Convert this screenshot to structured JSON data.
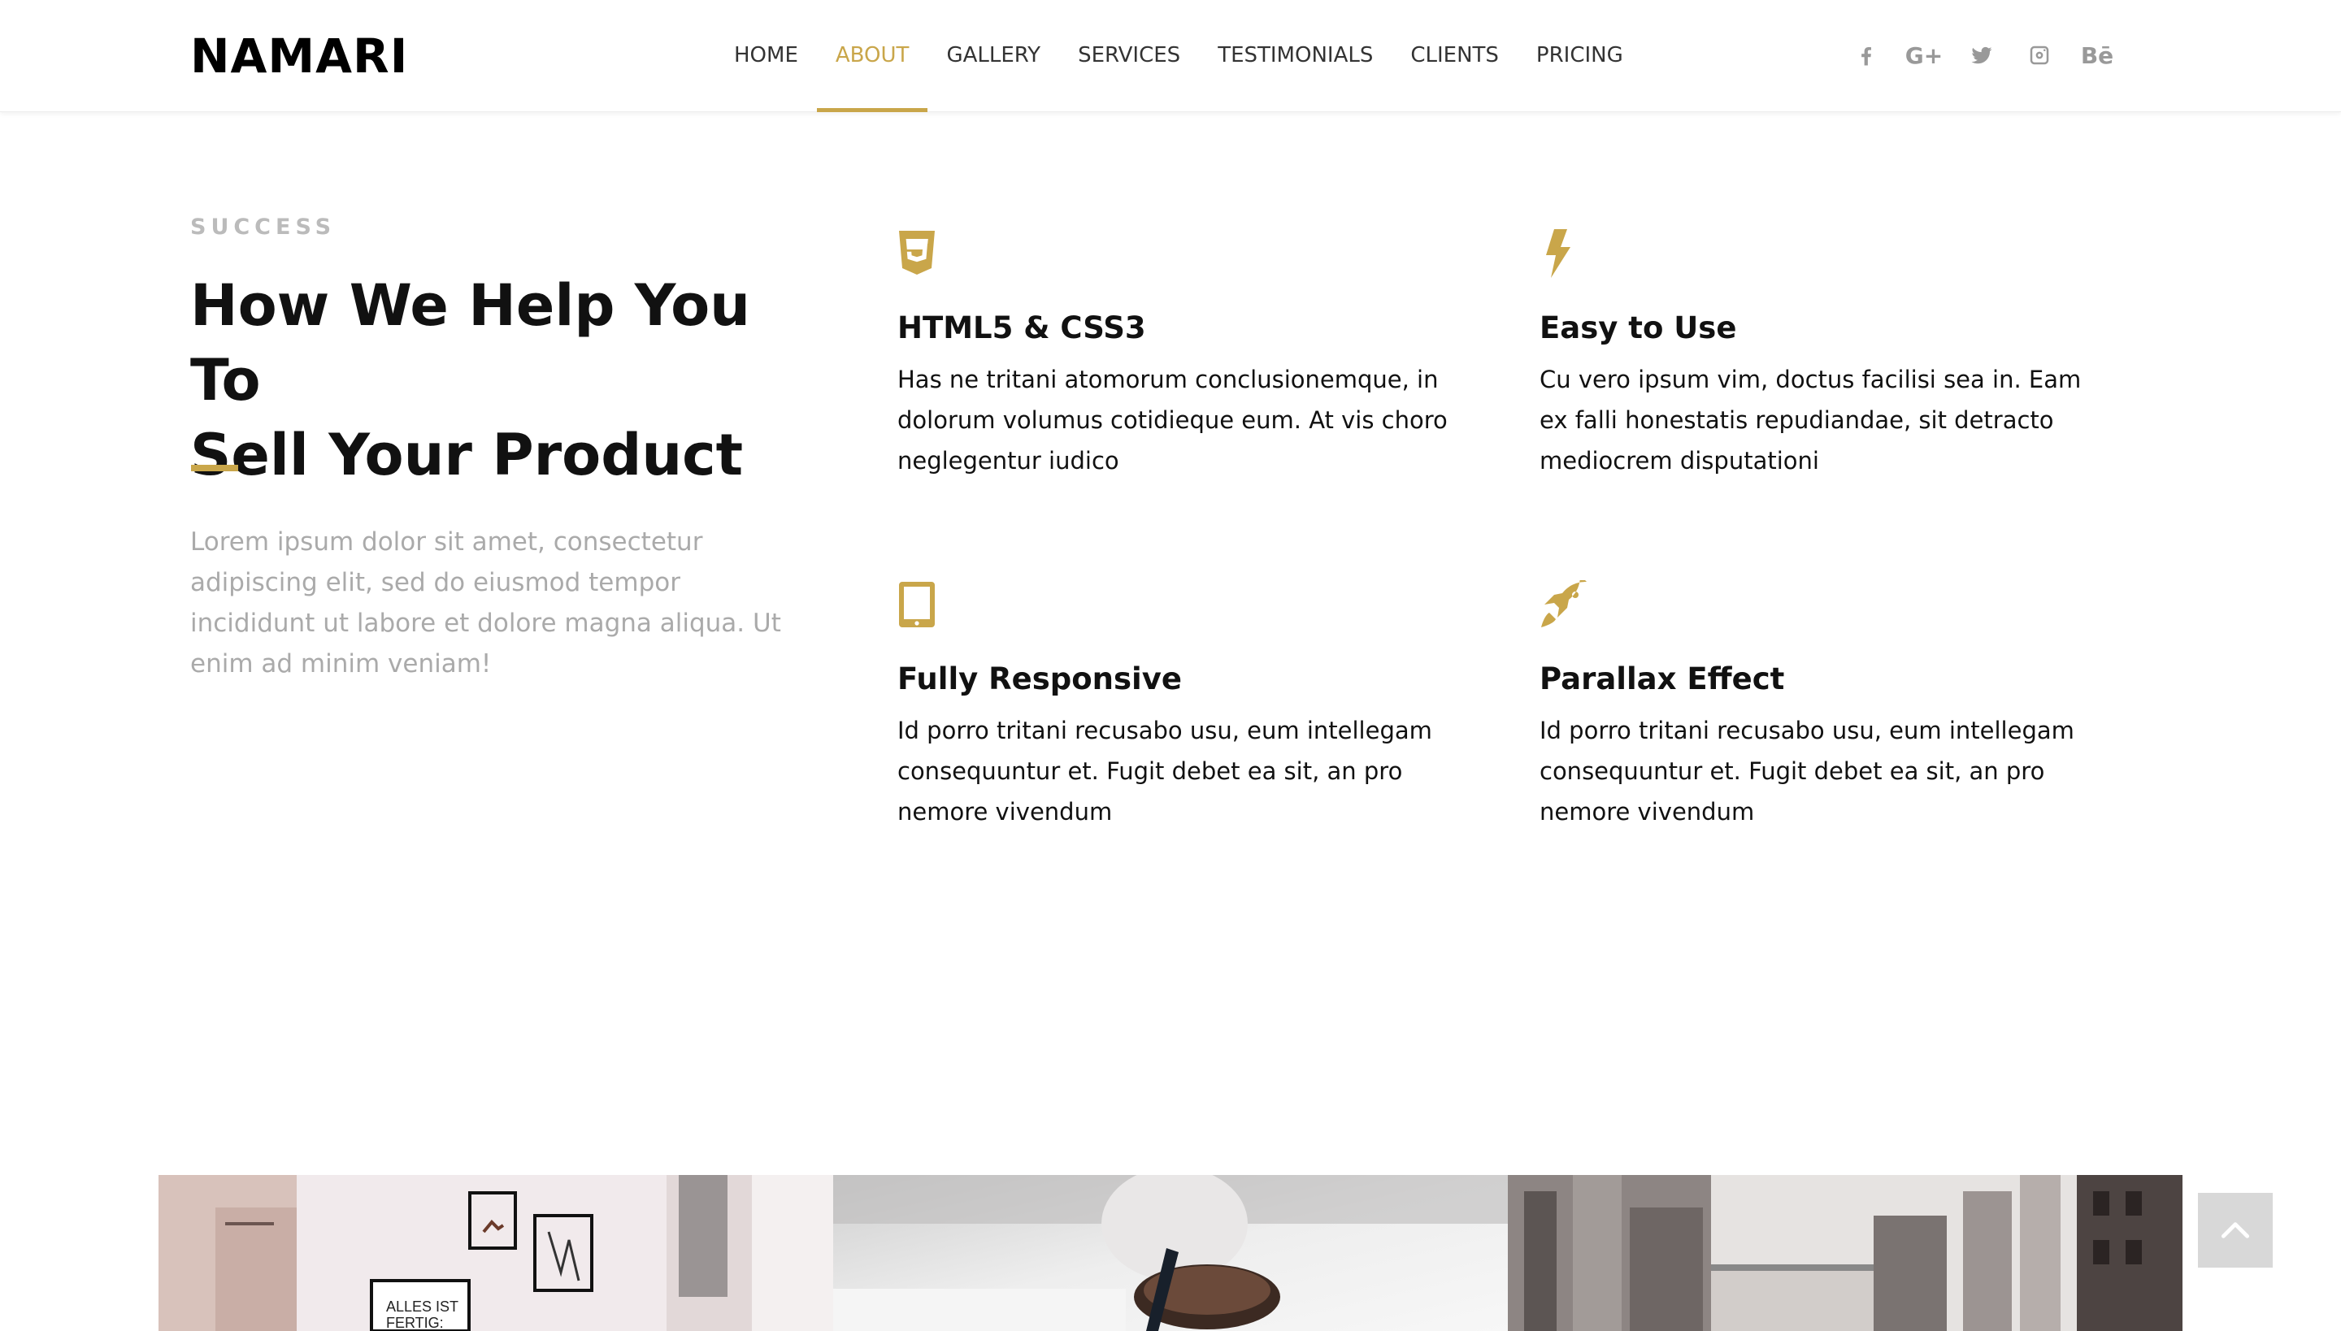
{
  "brand": {
    "logo": "NAMARI",
    "accent": "#c9a64a"
  },
  "nav": {
    "items": [
      "HOME",
      "ABOUT",
      "GALLERY",
      "SERVICES",
      "TESTIMONIALS",
      "CLIENTS",
      "PRICING"
    ],
    "active": "ABOUT"
  },
  "social": {
    "icons": [
      "facebook-icon",
      "google-plus-icon",
      "twitter-icon",
      "instagram-icon",
      "behance-icon"
    ],
    "google_plus_label": "G+",
    "behance_label": "Bē"
  },
  "about": {
    "eyebrow": "SUCCESS",
    "title_line1": "How We Help You To",
    "title_line2": "Sell Your Product",
    "intro": "Lorem ipsum dolor sit amet, consectetur adipiscing elit, sed do eiusmod tempor incididunt ut labore et dolore magna aliqua. Ut enim ad minim veniam!"
  },
  "features": [
    {
      "icon": "html5-icon",
      "title": "HTML5 & CSS3",
      "text": "Has ne tritani atomorum conclusionemque, in dolorum volumus cotidieque eum. At vis choro neglegentur iudico"
    },
    {
      "icon": "lightning-icon",
      "title": "Easy to Use",
      "text": "Cu vero ipsum vim, doctus facilisi sea in. Eam ex falli honestatis repudiandae, sit detracto mediocrem disputationi"
    },
    {
      "icon": "tablet-icon",
      "title": "Fully Responsive",
      "text": "Id porro tritani recusabo usu, eum intellegam consequuntur et. Fugit debet ea sit, an pro nemore vivendum"
    },
    {
      "icon": "rocket-icon",
      "title": "Parallax Effect",
      "text": "Id porro tritani recusabo usu, eum intellegam consequuntur et. Fugit debet ea sit, an pro nemore vivendum"
    }
  ],
  "gallery": {
    "poster_text_line1": "ALLES IST",
    "poster_text_line2": "FERTIG:"
  },
  "back_to_top": {
    "icon": "chevron-up-icon"
  }
}
